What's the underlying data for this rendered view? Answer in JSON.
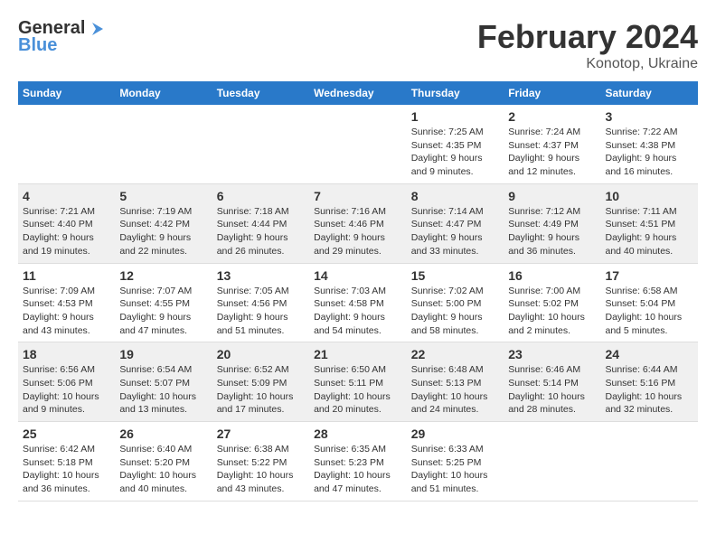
{
  "header": {
    "logo_text_1": "General",
    "logo_text_2": "Blue",
    "title": "February 2024",
    "subtitle": "Konotop, Ukraine"
  },
  "columns": [
    "Sunday",
    "Monday",
    "Tuesday",
    "Wednesday",
    "Thursday",
    "Friday",
    "Saturday"
  ],
  "weeks": [
    {
      "days": [
        null,
        null,
        null,
        null,
        {
          "num": "1",
          "sunrise": "7:25 AM",
          "sunset": "4:35 PM",
          "daylight": "9 hours and 9 minutes."
        },
        {
          "num": "2",
          "sunrise": "7:24 AM",
          "sunset": "4:37 PM",
          "daylight": "9 hours and 12 minutes."
        },
        {
          "num": "3",
          "sunrise": "7:22 AM",
          "sunset": "4:38 PM",
          "daylight": "9 hours and 16 minutes."
        }
      ]
    },
    {
      "days": [
        {
          "num": "4",
          "sunrise": "7:21 AM",
          "sunset": "4:40 PM",
          "daylight": "9 hours and 19 minutes."
        },
        {
          "num": "5",
          "sunrise": "7:19 AM",
          "sunset": "4:42 PM",
          "daylight": "9 hours and 22 minutes."
        },
        {
          "num": "6",
          "sunrise": "7:18 AM",
          "sunset": "4:44 PM",
          "daylight": "9 hours and 26 minutes."
        },
        {
          "num": "7",
          "sunrise": "7:16 AM",
          "sunset": "4:46 PM",
          "daylight": "9 hours and 29 minutes."
        },
        {
          "num": "8",
          "sunrise": "7:14 AM",
          "sunset": "4:47 PM",
          "daylight": "9 hours and 33 minutes."
        },
        {
          "num": "9",
          "sunrise": "7:12 AM",
          "sunset": "4:49 PM",
          "daylight": "9 hours and 36 minutes."
        },
        {
          "num": "10",
          "sunrise": "7:11 AM",
          "sunset": "4:51 PM",
          "daylight": "9 hours and 40 minutes."
        }
      ]
    },
    {
      "days": [
        {
          "num": "11",
          "sunrise": "7:09 AM",
          "sunset": "4:53 PM",
          "daylight": "9 hours and 43 minutes."
        },
        {
          "num": "12",
          "sunrise": "7:07 AM",
          "sunset": "4:55 PM",
          "daylight": "9 hours and 47 minutes."
        },
        {
          "num": "13",
          "sunrise": "7:05 AM",
          "sunset": "4:56 PM",
          "daylight": "9 hours and 51 minutes."
        },
        {
          "num": "14",
          "sunrise": "7:03 AM",
          "sunset": "4:58 PM",
          "daylight": "9 hours and 54 minutes."
        },
        {
          "num": "15",
          "sunrise": "7:02 AM",
          "sunset": "5:00 PM",
          "daylight": "9 hours and 58 minutes."
        },
        {
          "num": "16",
          "sunrise": "7:00 AM",
          "sunset": "5:02 PM",
          "daylight": "10 hours and 2 minutes."
        },
        {
          "num": "17",
          "sunrise": "6:58 AM",
          "sunset": "5:04 PM",
          "daylight": "10 hours and 5 minutes."
        }
      ]
    },
    {
      "days": [
        {
          "num": "18",
          "sunrise": "6:56 AM",
          "sunset": "5:06 PM",
          "daylight": "10 hours and 9 minutes."
        },
        {
          "num": "19",
          "sunrise": "6:54 AM",
          "sunset": "5:07 PM",
          "daylight": "10 hours and 13 minutes."
        },
        {
          "num": "20",
          "sunrise": "6:52 AM",
          "sunset": "5:09 PM",
          "daylight": "10 hours and 17 minutes."
        },
        {
          "num": "21",
          "sunrise": "6:50 AM",
          "sunset": "5:11 PM",
          "daylight": "10 hours and 20 minutes."
        },
        {
          "num": "22",
          "sunrise": "6:48 AM",
          "sunset": "5:13 PM",
          "daylight": "10 hours and 24 minutes."
        },
        {
          "num": "23",
          "sunrise": "6:46 AM",
          "sunset": "5:14 PM",
          "daylight": "10 hours and 28 minutes."
        },
        {
          "num": "24",
          "sunrise": "6:44 AM",
          "sunset": "5:16 PM",
          "daylight": "10 hours and 32 minutes."
        }
      ]
    },
    {
      "days": [
        {
          "num": "25",
          "sunrise": "6:42 AM",
          "sunset": "5:18 PM",
          "daylight": "10 hours and 36 minutes."
        },
        {
          "num": "26",
          "sunrise": "6:40 AM",
          "sunset": "5:20 PM",
          "daylight": "10 hours and 40 minutes."
        },
        {
          "num": "27",
          "sunrise": "6:38 AM",
          "sunset": "5:22 PM",
          "daylight": "10 hours and 43 minutes."
        },
        {
          "num": "28",
          "sunrise": "6:35 AM",
          "sunset": "5:23 PM",
          "daylight": "10 hours and 47 minutes."
        },
        {
          "num": "29",
          "sunrise": "6:33 AM",
          "sunset": "5:25 PM",
          "daylight": "10 hours and 51 minutes."
        },
        null,
        null
      ]
    }
  ],
  "labels": {
    "sunrise_label": "Sunrise:",
    "sunset_label": "Sunset:",
    "daylight_label": "Daylight:"
  }
}
